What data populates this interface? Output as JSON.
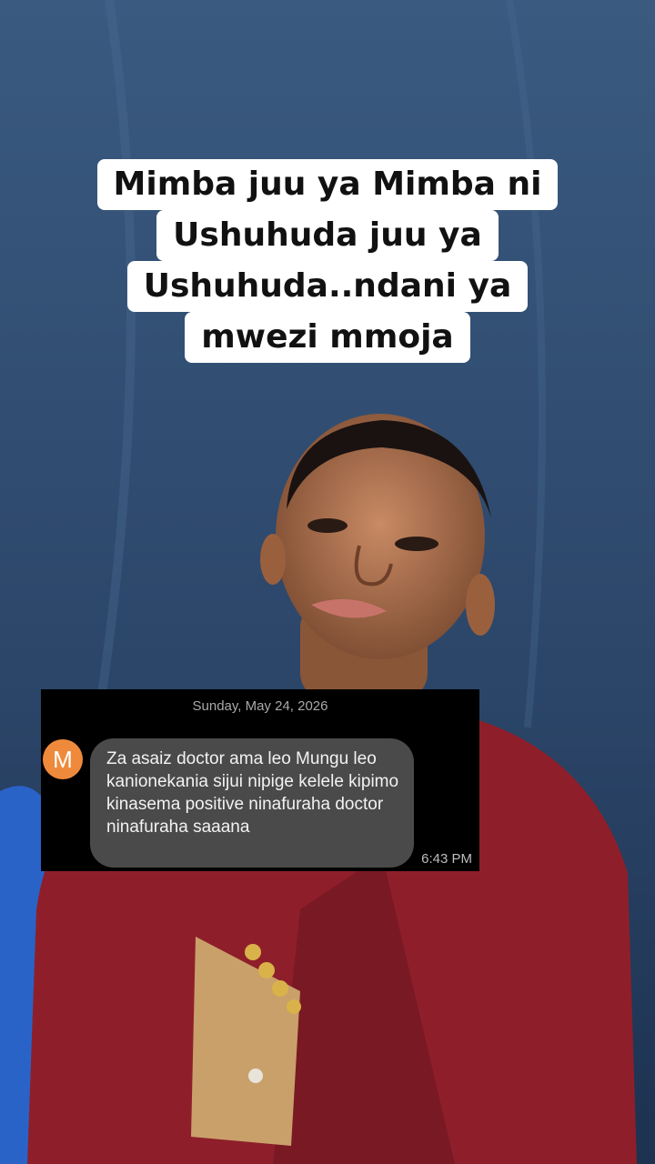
{
  "caption": {
    "lines": [
      "Mimba juu ya Mimba ni",
      "Ushuhuda juu ya",
      "Ushuhuda..ndani ya",
      "mwezi mmoja"
    ]
  },
  "sms": {
    "date": "Sunday, May 24, 2026",
    "avatar_letter": "M",
    "message": "Za asaiz doctor ama leo Mungu leo kanionekania sijui nipige kelele kipimo kinasema positive ninafuraha doctor ninafuraha saaana",
    "time": "6:43 PM"
  },
  "colors": {
    "backdrop": "#2f4a6e",
    "jacket": "#8e1f2a",
    "avatar": "#ef8a3c",
    "bubble": "#4a4a4a"
  }
}
